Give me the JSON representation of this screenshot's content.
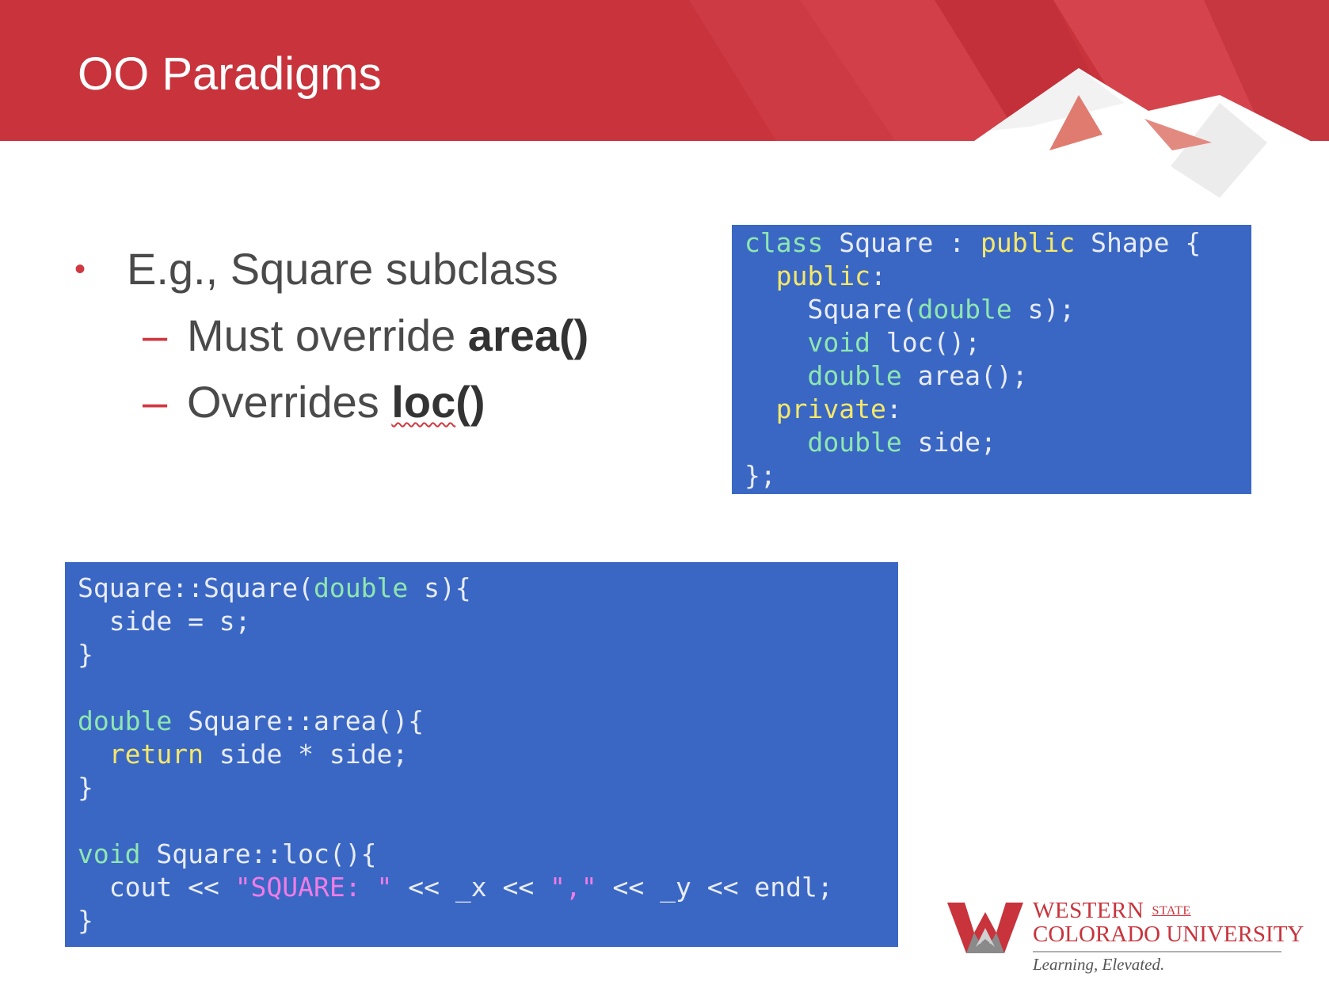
{
  "slide": {
    "title": "OO Paradigms"
  },
  "bullets": {
    "main": "E.g., Square subclass",
    "sub1_prefix": "Must override ",
    "sub1_bold": "area()",
    "sub2_prefix": "Overrides ",
    "sub2_bold_underlined": "loc",
    "sub2_bold_rest": "()"
  },
  "code_declaration": {
    "lines": [
      "class Square : public Shape {",
      "  public:",
      "    Square(double s);",
      "    void loc();",
      "    double area();",
      "  private:",
      "    double side;",
      "};"
    ]
  },
  "code_definitions": {
    "lines": [
      "Square::Square(double s){",
      "  side = s;",
      "}",
      "",
      "double Square::area(){",
      "  return side * side;",
      "}",
      "",
      "void Square::loc(){",
      "  cout << \"SQUARE: \" << _x << \",\" << _y << endl;",
      "}"
    ]
  },
  "logo": {
    "name_line1": "WESTERN",
    "name_state": "STATE",
    "name_line2": "COLORADO UNIVERSITY",
    "tagline": "Learning, Elevated."
  },
  "colors": {
    "header_red": "#c8333c",
    "accent_red": "#d0393f",
    "code_background": "#3a67c4",
    "code_text": "#e8ecf6",
    "code_keyword_green": "#8ee7b0",
    "code_keyword_yellow": "#f5e86a",
    "code_string_pink": "#f07ce6",
    "body_text": "#4a4a4a"
  }
}
